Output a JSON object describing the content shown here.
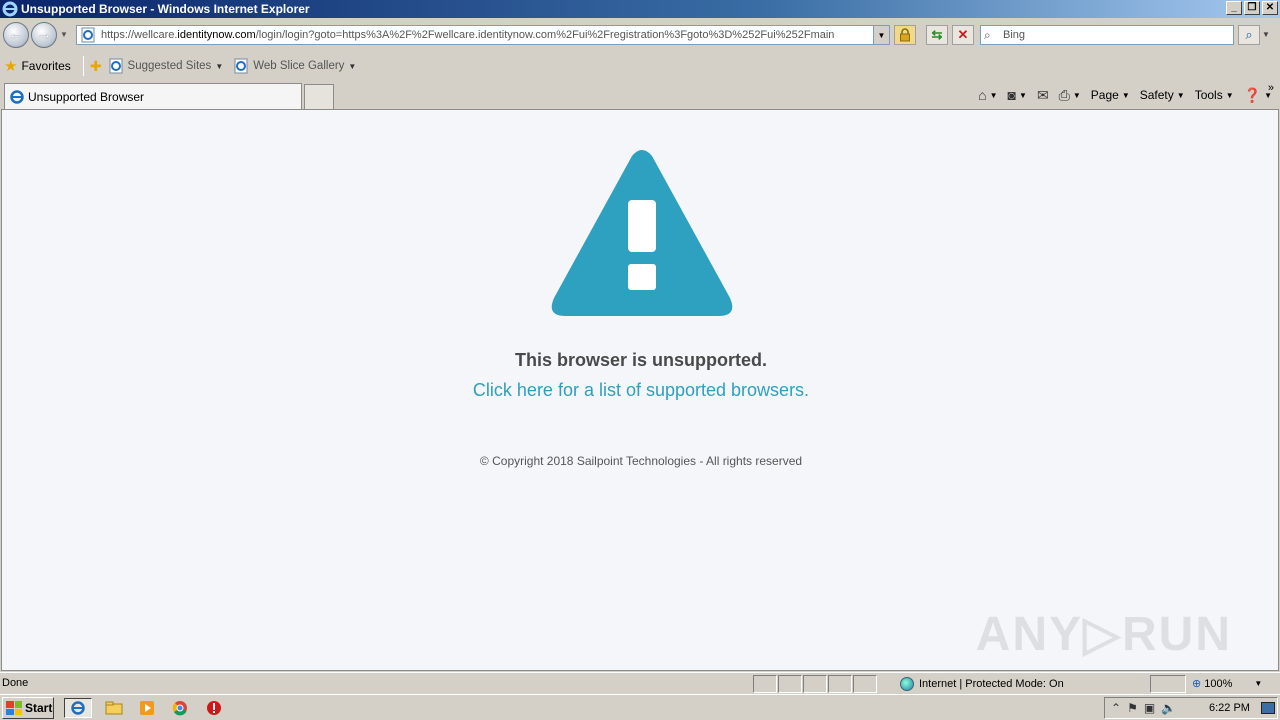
{
  "window": {
    "title": "Unsupported Browser - Windows Internet Explorer",
    "minimize": "_",
    "restore": "❐",
    "close": "✕"
  },
  "address": {
    "url_prefix": "https://wellcare.",
    "url_host": "identitynow.com",
    "url_rest": "/login/login?goto=https%3A%2F%2Fwellcare.identitynow.com%2Fui%2Fregistration%3Fgoto%3D%252Fui%252Fmain"
  },
  "search": {
    "placeholder": "Bing"
  },
  "favorites_bar": {
    "favorites_label": "Favorites",
    "items": [
      {
        "label": "Suggested Sites"
      },
      {
        "label": "Web Slice Gallery"
      }
    ]
  },
  "tabs": [
    {
      "label": "Unsupported Browser"
    }
  ],
  "command_bar": {
    "page": "Page",
    "safety": "Safety",
    "tools": "Tools"
  },
  "page": {
    "heading": "This browser is unsupported.",
    "link": "Click here for a list of supported browsers.",
    "copyright": "© Copyright 2018 Sailpoint Technologies - All rights reserved",
    "accent_color": "#2ea0c0"
  },
  "statusbar": {
    "status": "Done",
    "zone": "Internet | Protected Mode: On",
    "zoom": "100%"
  },
  "taskbar": {
    "start": "Start",
    "clock": "6:22 PM"
  },
  "watermark": "ANY▷RUN"
}
